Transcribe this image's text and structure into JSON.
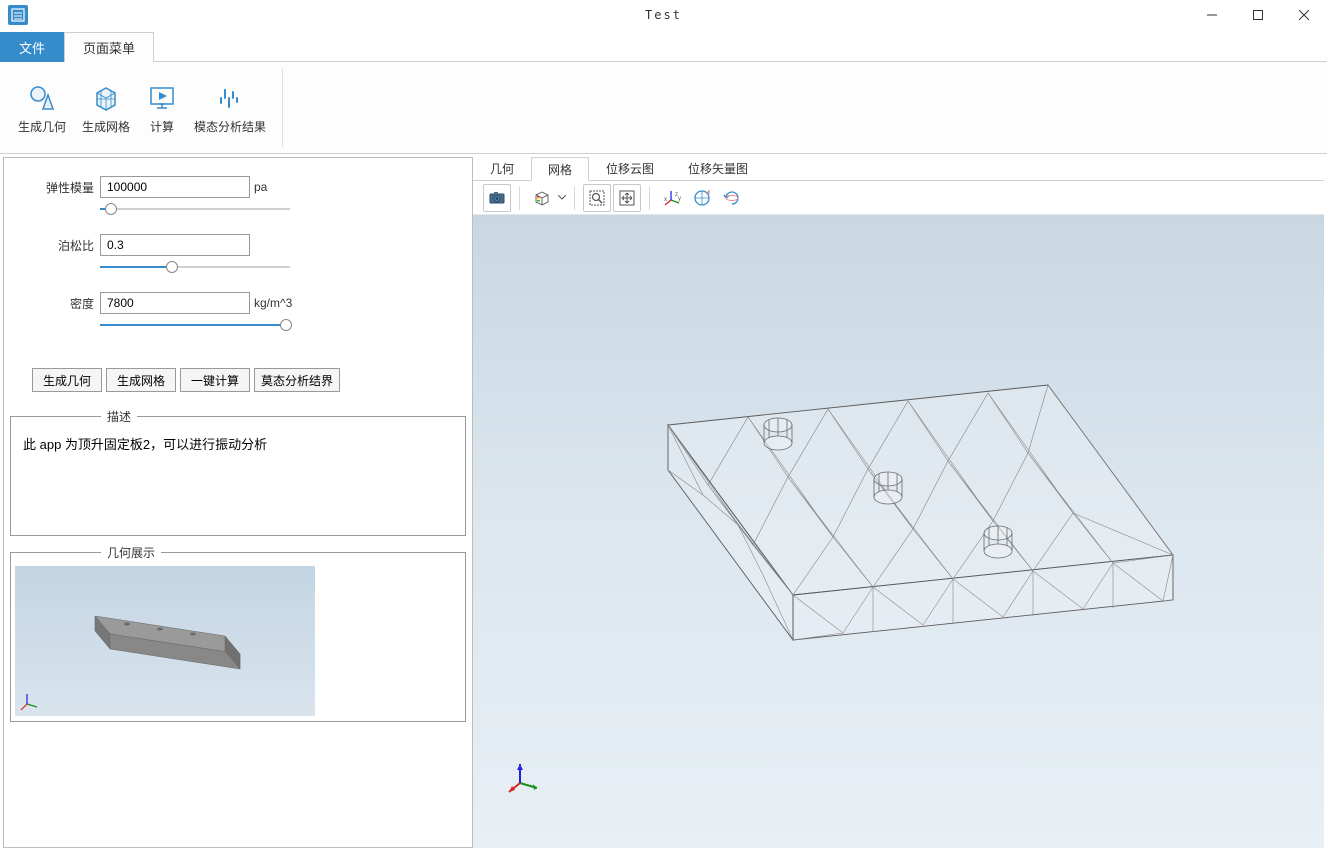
{
  "window": {
    "title": "Test"
  },
  "menu_tabs": {
    "file": "文件",
    "page": "页面菜单"
  },
  "ribbon": {
    "gen_geom": "生成几何",
    "gen_mesh": "生成网格",
    "calculate": "计算",
    "modal_result": "模态分析结果"
  },
  "params": {
    "elastic_label": "弹性模量",
    "elastic_value": "100000",
    "elastic_unit": "pa",
    "poisson_label": "泊松比",
    "poisson_value": "0.3",
    "density_label": "密度",
    "density_value": "7800",
    "density_unit": "kg/m^3"
  },
  "buttons": {
    "gen_geom": "生成几何",
    "gen_mesh": "生成网格",
    "one_click": "一键计算",
    "modal_trunc": "莫态分析结界"
  },
  "desc": {
    "legend": "描述",
    "text": "此 app 为顶升固定板2，可以进行振动分析"
  },
  "geom": {
    "legend": "几何展示"
  },
  "view_tabs": {
    "geom": "几何",
    "mesh": "网格",
    "disp_cloud": "位移云图",
    "disp_vec": "位移矢量图"
  }
}
